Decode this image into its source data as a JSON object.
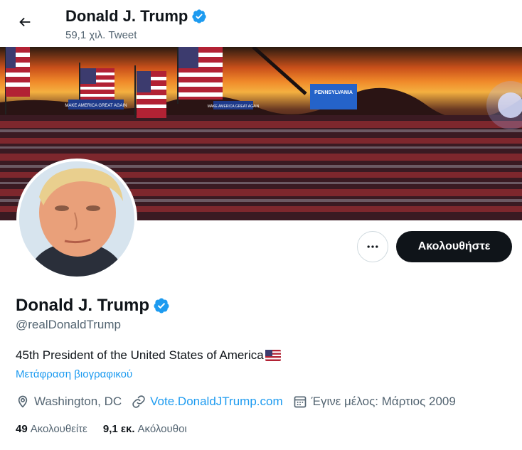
{
  "header": {
    "name": "Donald J. Trump",
    "tweet_count": "59,1 χιλ. Tweet"
  },
  "banner": {
    "signs": [
      "MAKE AMERICA GREAT AGAIN",
      "MAKE AMERICA GREAT AGAIN",
      "PENNSYLVANIA"
    ]
  },
  "actions": {
    "follow_label": "Ακολουθήστε"
  },
  "profile": {
    "name": "Donald J. Trump",
    "handle": "@realDonaldTrump",
    "bio": "45th President of the United States of America",
    "translate_label": "Μετάφραση βιογραφικού",
    "location": "Washington, DC",
    "website": "Vote.DonaldJTrump.com",
    "joined": "Έγινε μέλος: Μάρτιος 2009"
  },
  "stats": {
    "following_count": "49",
    "following_label": "Ακολουθείτε",
    "followers_count": "9,1 εκ.",
    "followers_label": "Ακόλουθοι"
  },
  "colors": {
    "accent": "#1d9bf0",
    "text": "#0f1419",
    "muted": "#536471",
    "button_dark": "#0f1419"
  }
}
